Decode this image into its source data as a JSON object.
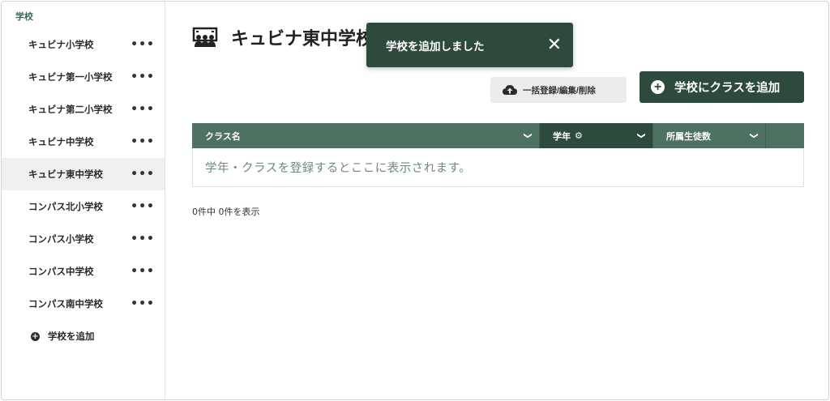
{
  "sidebar": {
    "header": "学校",
    "items": [
      {
        "label": "キュビナ小学校",
        "active": false
      },
      {
        "label": "キュビナ第一小学校",
        "active": false
      },
      {
        "label": "キュビナ第二小学校",
        "active": false
      },
      {
        "label": "キュビナ中学校",
        "active": false
      },
      {
        "label": "キュビナ東中学校",
        "active": true
      },
      {
        "label": "コンパス北小学校",
        "active": false
      },
      {
        "label": "コンパス小学校",
        "active": false
      },
      {
        "label": "コンパス中学校",
        "active": false
      },
      {
        "label": "コンパス南中学校",
        "active": false
      }
    ],
    "more_label": "•••",
    "add_school_label": "学校を追加"
  },
  "header": {
    "title": "キュビナ東中学校",
    "icon": "people-group-icon"
  },
  "toast": {
    "message": "学校を追加しました",
    "close_icon": "close-icon"
  },
  "toolbar": {
    "bulk_label": "一括登録/編集/削除",
    "add_class_label": "学校にクラスを追加"
  },
  "table": {
    "columns": [
      "クラス名",
      "学年",
      "所属生徒数"
    ],
    "empty_message": "学年・クラスを登録するとここに表示されます。"
  },
  "footer": {
    "result_count": "0件中 0件を表示"
  },
  "colors": {
    "accent": "#2d4a3d",
    "header_bg": "#4d7262",
    "sidebar_active_bg": "#efefef"
  }
}
